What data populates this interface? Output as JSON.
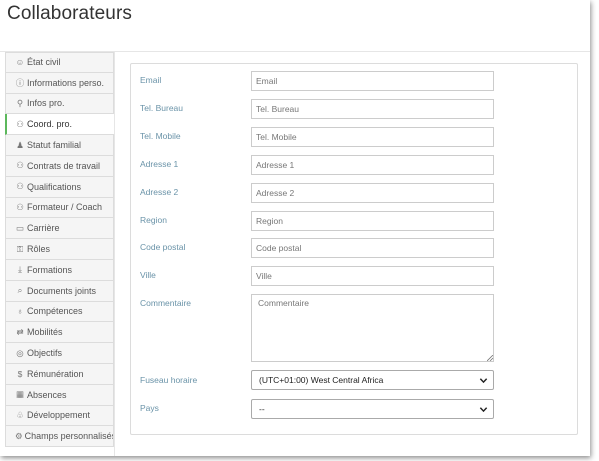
{
  "page": {
    "title": "Collaborateurs"
  },
  "sidebar": {
    "items": [
      {
        "label": "État civil",
        "icon": "smiley-icon",
        "glyph": "☺",
        "active": false
      },
      {
        "label": "Informations perso.",
        "icon": "info-circle-icon",
        "glyph": "ⓘ",
        "active": false
      },
      {
        "label": "Infos pro.",
        "icon": "user-icon",
        "glyph": "⚲",
        "active": false
      },
      {
        "label": "Coord. pro.",
        "icon": "users-icon",
        "glyph": "⚇",
        "active": true
      },
      {
        "label": "Statut familial",
        "icon": "family-icon",
        "glyph": "♟",
        "active": false
      },
      {
        "label": "Contrats de travail",
        "icon": "contract-user-icon",
        "glyph": "⚇",
        "active": false
      },
      {
        "label": "Qualifications",
        "icon": "group-icon",
        "glyph": "⚇",
        "active": false
      },
      {
        "label": "Formateur / Coach",
        "icon": "trainer-icon",
        "glyph": "⚇",
        "active": false
      },
      {
        "label": "Carrière",
        "icon": "laptop-icon",
        "glyph": "▭",
        "active": false
      },
      {
        "label": "Rôles",
        "icon": "roles-icon",
        "glyph": "⚿",
        "active": false
      },
      {
        "label": "Formations",
        "icon": "download-icon",
        "glyph": "⤓",
        "active": false
      },
      {
        "label": "Documents joints",
        "icon": "paperclip-icon",
        "glyph": "⌕",
        "active": false
      },
      {
        "label": "Compétences",
        "icon": "lightbulb-icon",
        "glyph": "♁",
        "active": false
      },
      {
        "label": "Mobilités",
        "icon": "transfer-icon",
        "glyph": "⇄",
        "active": false
      },
      {
        "label": "Objectifs",
        "icon": "target-icon",
        "glyph": "◎",
        "active": false
      },
      {
        "label": "Rémunération",
        "icon": "dollar-icon",
        "glyph": "$",
        "active": false
      },
      {
        "label": "Absences",
        "icon": "calendar-icon",
        "glyph": "▦",
        "active": false
      },
      {
        "label": "Développement",
        "icon": "development-icon",
        "glyph": "♧",
        "active": false
      },
      {
        "label": "Champs personnalisés",
        "icon": "gear-icon",
        "glyph": "⚙",
        "active": false
      }
    ]
  },
  "form": {
    "fields": [
      {
        "label": "Email",
        "placeholder": "Email",
        "value": ""
      },
      {
        "label": "Tel. Bureau",
        "placeholder": "Tel. Bureau",
        "value": ""
      },
      {
        "label": "Tel. Mobile",
        "placeholder": "Tel. Mobile",
        "value": ""
      },
      {
        "label": "Adresse 1",
        "placeholder": "Adresse 1",
        "value": ""
      },
      {
        "label": "Adresse 2",
        "placeholder": "Adresse 2",
        "value": ""
      },
      {
        "label": "Region",
        "placeholder": "Region",
        "value": ""
      },
      {
        "label": "Code postal",
        "placeholder": "Code postal",
        "value": ""
      },
      {
        "label": "Ville",
        "placeholder": "Ville",
        "value": ""
      }
    ],
    "commentaire": {
      "label": "Commentaire",
      "placeholder": "Commentaire"
    },
    "fuseau": {
      "label": "Fuseau horaire",
      "value": "(UTC+01:00) West Central Africa"
    },
    "pays": {
      "label": "Pays",
      "value": "--"
    }
  },
  "colors": {
    "label_color": "#6a93a8",
    "active_accent": "#5cb85c"
  }
}
